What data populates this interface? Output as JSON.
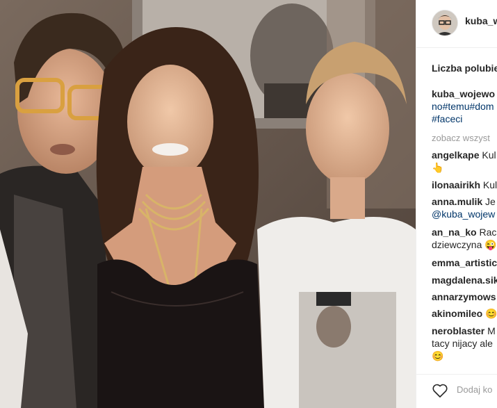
{
  "header": {
    "username": "kuba_wo"
  },
  "likes": {
    "label": "Liczba polubie"
  },
  "caption": {
    "username": "kuba_wojewo",
    "hashtags_line1": "no#temu#dom",
    "hashtags_line2": "#faceci"
  },
  "see_all": "zobacz wszyst",
  "comments": [
    {
      "username": "angelkape",
      "text": "Kul",
      "line2": "👆"
    },
    {
      "username": "ilonaairikh",
      "text": "Kul"
    },
    {
      "username": "anna.mulik",
      "text": "Je",
      "mention": "@kuba_wojew"
    },
    {
      "username": "an_na_ko",
      "text": "Rac",
      "line2": "dziewczyna 😜"
    },
    {
      "username": "emma_artistic",
      "text": ""
    },
    {
      "username": "magdalena.sik",
      "text": ""
    },
    {
      "username": "annarzymows",
      "text": ""
    },
    {
      "username": "akinomileo",
      "text": "😊"
    },
    {
      "username": "neroblaster",
      "text": "M",
      "line2": "tacy nijacy ale",
      "line3": "😊"
    }
  ],
  "footer": {
    "add_comment": "Dodaj ko"
  },
  "icons": {
    "like": "heart-icon"
  }
}
